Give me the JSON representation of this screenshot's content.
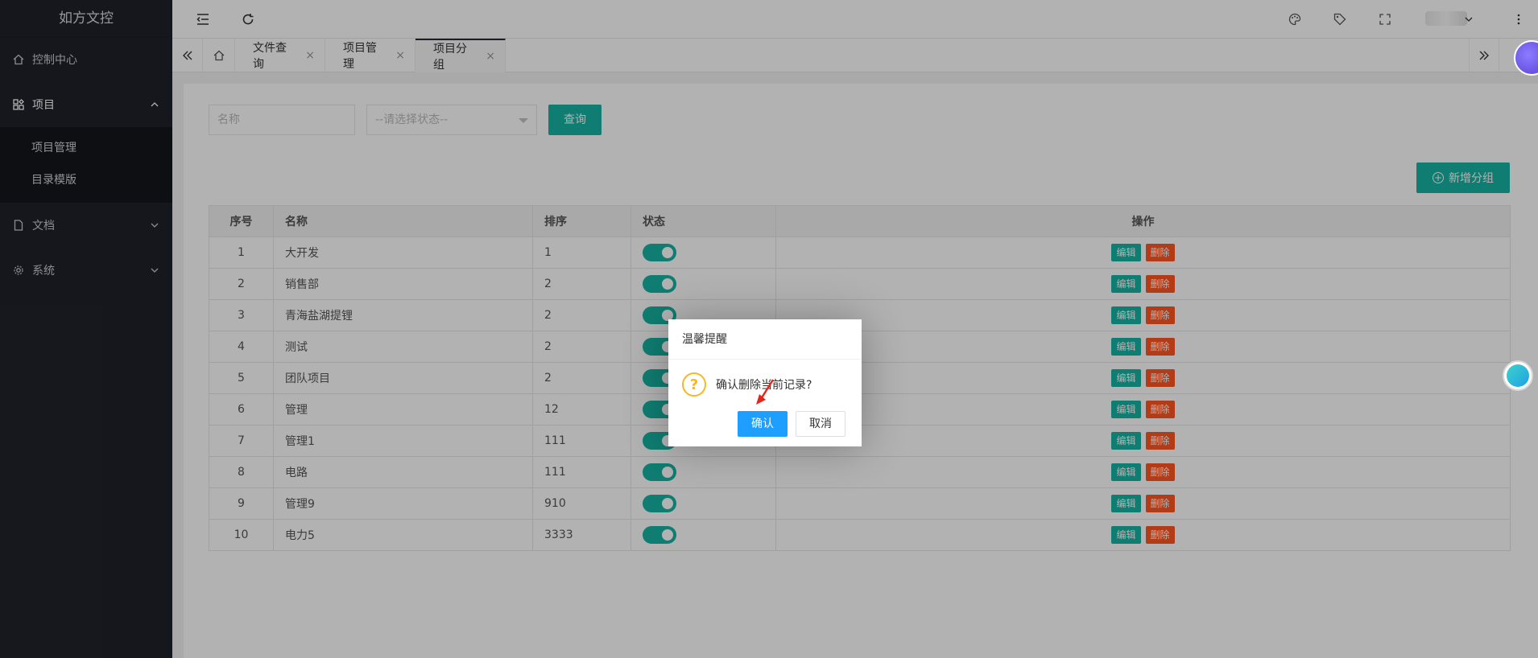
{
  "sidebar": {
    "logo": "如方文控",
    "items": [
      {
        "label": "控制中心",
        "icon": "home-icon"
      },
      {
        "label": "项目",
        "icon": "apps-icon",
        "open": true,
        "children": [
          {
            "label": "项目管理"
          },
          {
            "label": "目录模版"
          }
        ]
      },
      {
        "label": "文档",
        "icon": "file-icon"
      },
      {
        "label": "系统",
        "icon": "gear-icon"
      }
    ]
  },
  "header": {
    "icons": [
      "menu-shrink-icon",
      "refresh-icon",
      "palette-icon",
      "tag-icon",
      "fullscreen-icon",
      "more-icon"
    ]
  },
  "tabs": {
    "items": [
      {
        "label": "文件查询",
        "active": false
      },
      {
        "label": "项目管理",
        "active": false
      },
      {
        "label": "项目分组",
        "active": true
      }
    ],
    "close_glyph": "×"
  },
  "search": {
    "name_placeholder": "名称",
    "status_placeholder": "--请选择状态--",
    "query_label": "查询",
    "add_label": "新增分组"
  },
  "table": {
    "headers": [
      "序号",
      "名称",
      "排序",
      "状态",
      "操作"
    ],
    "edit_label": "编辑",
    "delete_label": "删除",
    "rows": [
      {
        "no": "1",
        "name": "大开发",
        "sort": "1"
      },
      {
        "no": "2",
        "name": "销售部",
        "sort": "2"
      },
      {
        "no": "3",
        "name": "青海盐湖提锂",
        "sort": "2"
      },
      {
        "no": "4",
        "name": "测试",
        "sort": "2"
      },
      {
        "no": "5",
        "name": "团队项目",
        "sort": "2"
      },
      {
        "no": "6",
        "name": "管理",
        "sort": "12"
      },
      {
        "no": "7",
        "name": "管理1",
        "sort": "111"
      },
      {
        "no": "8",
        "name": "电路",
        "sort": "111"
      },
      {
        "no": "9",
        "name": "管理9",
        "sort": "910"
      },
      {
        "no": "10",
        "name": "电力5",
        "sort": "3333"
      }
    ]
  },
  "dialog": {
    "title": "温馨提醒",
    "message": "确认删除当前记录?",
    "ok_label": "确认",
    "cancel_label": "取消"
  },
  "colors": {
    "primary": "#16b3a2",
    "danger": "#ff5722",
    "dialog_ok": "#1e9fff",
    "sidebar_bg": "#20222a"
  }
}
